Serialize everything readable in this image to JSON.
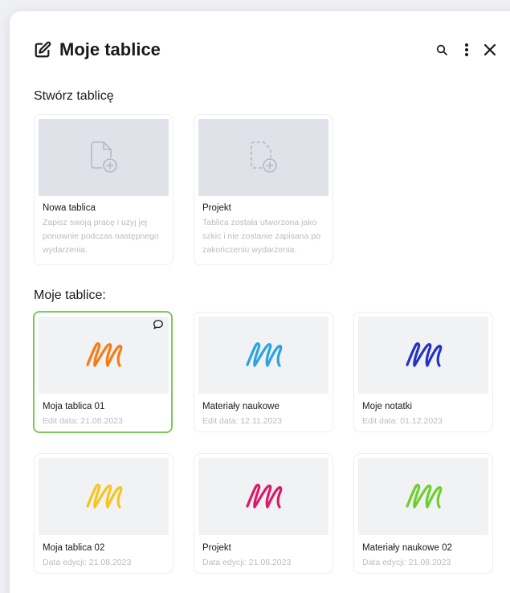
{
  "header": {
    "title": "Moje tablice"
  },
  "create_section": {
    "label": "Stwórz tablicę",
    "items": [
      {
        "title": "Nowa tablica",
        "description": "Zapisz swoją pracę i użyj jej ponownie podczas następnego wydarzenia.",
        "icon": "new-document-icon"
      },
      {
        "title": "Projekt",
        "description": "Tablica została utworzona jako szkic i nie zostanie zapisana po zakończeniu wydarzenia.",
        "icon": "draft-document-icon"
      }
    ]
  },
  "boards_section": {
    "label": "Moje tablice:",
    "items": [
      {
        "title": "Moja tablica 01",
        "date": "Edit data: 21.08.2023",
        "color": "#f57c14",
        "selected": true,
        "has_comment": true
      },
      {
        "title": "Materiały naukowe",
        "date": "Edit data: 12.11.2023",
        "color": "#2ba3e0"
      },
      {
        "title": "Moje notatki",
        "date": "Edit data: 01.12.2023",
        "color": "#2433c4"
      },
      {
        "title": "Moja tablica 02",
        "date": "Data edycji: 21.08.2023",
        "color": "#f7c51b"
      },
      {
        "title": "Projekt",
        "date": "Data edycji: 21.08.2023",
        "color": "#d81b6a"
      },
      {
        "title": "Materiały naukowe 02",
        "date": "Data edycji: 21.08.2023",
        "color": "#6ccf2a"
      }
    ]
  },
  "colors": {
    "selected_border": "#7cc95a",
    "muted_text": "#b9bcc4"
  }
}
